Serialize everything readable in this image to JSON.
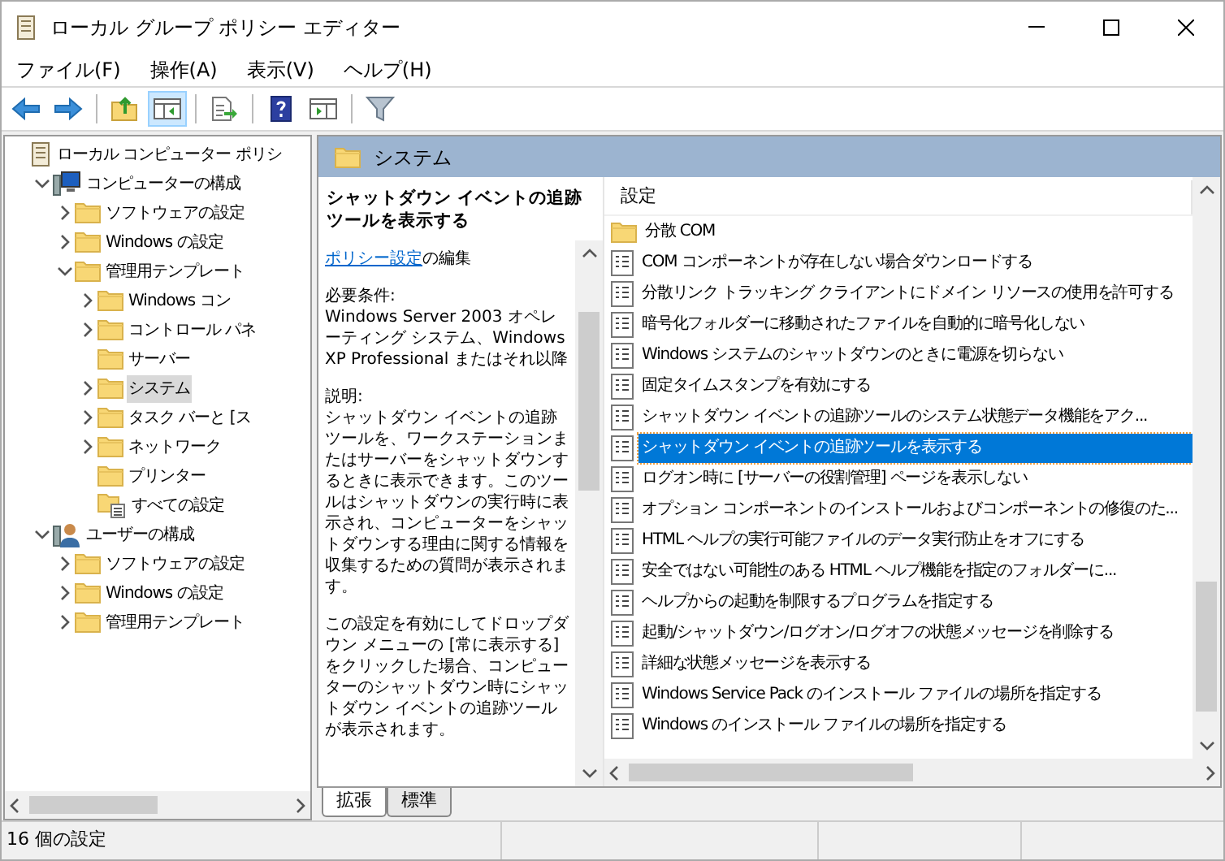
{
  "window": {
    "title": "ローカル グループ ポリシー エディター"
  },
  "menu": [
    {
      "label": "ファイル(F)"
    },
    {
      "label": "操作(A)"
    },
    {
      "label": "表示(V)"
    },
    {
      "label": "ヘルプ(H)"
    }
  ],
  "toolbar_buttons": [
    {
      "pressed": false
    },
    {
      "pressed": false
    },
    {
      "pressed": false
    },
    {
      "pressed": true
    },
    {
      "pressed": false
    },
    {
      "pressed": false
    },
    {
      "pressed": false
    },
    {
      "pressed": false
    }
  ],
  "tree": [
    {
      "label": "ローカル コンピューター ポリシ",
      "kind": "root",
      "selected": false,
      "children": [
        {
          "label": "コンピューターの構成",
          "kind": "computer",
          "expanded": true,
          "selected": false,
          "children": [
            {
              "label": "ソフトウェアの設定",
              "kind": "folder",
              "expanded": false,
              "selected": false
            },
            {
              "label": "Windows の設定",
              "kind": "folder",
              "expanded": false,
              "selected": false
            },
            {
              "label": "管理用テンプレート",
              "kind": "folder",
              "expanded": true,
              "selected": false,
              "children": [
                {
                  "label": "Windows コン",
                  "kind": "folder",
                  "expanded": false,
                  "selected": false
                },
                {
                  "label": "コントロール パネ",
                  "kind": "folder",
                  "expanded": false,
                  "selected": false
                },
                {
                  "label": "サーバー",
                  "kind": "folder",
                  "selected": false
                },
                {
                  "label": "システム",
                  "kind": "folder",
                  "expanded": false,
                  "selected": true
                },
                {
                  "label": "タスク バーと [ス",
                  "kind": "folder",
                  "expanded": false,
                  "selected": false
                },
                {
                  "label": "ネットワーク",
                  "kind": "folder",
                  "expanded": false,
                  "selected": false
                },
                {
                  "label": "プリンター",
                  "kind": "folder",
                  "selected": false
                },
                {
                  "label": "すべての設定",
                  "kind": "settings",
                  "selected": false
                }
              ]
            }
          ]
        },
        {
          "label": "ユーザーの構成",
          "kind": "user",
          "expanded": true,
          "selected": false,
          "children": [
            {
              "label": "ソフトウェアの設定",
              "kind": "folder",
              "expanded": false,
              "selected": false
            },
            {
              "label": "Windows の設定",
              "kind": "folder",
              "expanded": false,
              "selected": false
            },
            {
              "label": "管理用テンプレート",
              "kind": "folder",
              "expanded": false,
              "selected": false
            }
          ]
        }
      ]
    }
  ],
  "header": {
    "title": "システム"
  },
  "details": {
    "title": "シャットダウン イベントの追跡ツールを表示する",
    "link": "ポリシー設定",
    "link_suffix": "の編集",
    "requirements_label": "必要条件:",
    "requirements": "Windows Server 2003 オペレーティング システム、Windows XP Professional またはそれ以降",
    "description_label": "説明:",
    "paragraphs": [
      "シャットダウン イベントの追跡ツールを、ワークステーションまたはサーバーをシャットダウンするときに表示できます。このツールはシャットダウンの実行時に表示され、コンピューターをシャットダウンする理由に関する情報を収集するための質問が表示されます。",
      "この設定を有効にしてドロップダウン メニューの [常に表示する] をクリックした場合、コンピューターのシャットダウン時にシャットダウン イベントの追跡ツールが表示されます。"
    ]
  },
  "settings": {
    "column": "設定",
    "items": [
      {
        "label": "分散 COM",
        "kind": "folder",
        "selected": false
      },
      {
        "label": "COM コンポーネントが存在しない場合ダウンロードする",
        "kind": "policy",
        "selected": false
      },
      {
        "label": "分散リンク トラッキング クライアントにドメイン リソースの使用を許可する",
        "kind": "policy",
        "selected": false
      },
      {
        "label": "暗号化フォルダーに移動されたファイルを自動的に暗号化しない",
        "kind": "policy",
        "selected": false
      },
      {
        "label": "Windows システムのシャットダウンのときに電源を切らない",
        "kind": "policy",
        "selected": false
      },
      {
        "label": "固定タイムスタンプを有効にする",
        "kind": "policy",
        "selected": false
      },
      {
        "label": "シャットダウン イベントの追跡ツールのシステム状態データ機能をアク...",
        "kind": "policy",
        "selected": false
      },
      {
        "label": "シャットダウン イベントの追跡ツールを表示する",
        "kind": "policy",
        "selected": true
      },
      {
        "label": "ログオン時に [サーバーの役割管理] ページを表示しない",
        "kind": "policy",
        "selected": false
      },
      {
        "label": "オプション コンポーネントのインストールおよびコンポーネントの修復のた...",
        "kind": "policy",
        "selected": false
      },
      {
        "label": "HTML ヘルプの実行可能ファイルのデータ実行防止をオフにする",
        "kind": "policy",
        "selected": false
      },
      {
        "label": "安全ではない可能性のある HTML ヘルプ機能を指定のフォルダーに...",
        "kind": "policy",
        "selected": false
      },
      {
        "label": "ヘルプからの起動を制限するプログラムを指定する",
        "kind": "policy",
        "selected": false
      },
      {
        "label": "起動/シャットダウン/ログオン/ログオフの状態メッセージを削除する",
        "kind": "policy",
        "selected": false
      },
      {
        "label": "詳細な状態メッセージを表示する",
        "kind": "policy",
        "selected": false
      },
      {
        "label": "Windows Service Pack のインストール ファイルの場所を指定する",
        "kind": "policy",
        "selected": false
      },
      {
        "label": "Windows のインストール ファイルの場所を指定する",
        "kind": "policy",
        "selected": false
      }
    ]
  },
  "tabs": [
    {
      "label": "拡張",
      "selected": true
    },
    {
      "label": "標準",
      "selected": false
    }
  ],
  "status_bar": {
    "text": "16 個の設定"
  }
}
